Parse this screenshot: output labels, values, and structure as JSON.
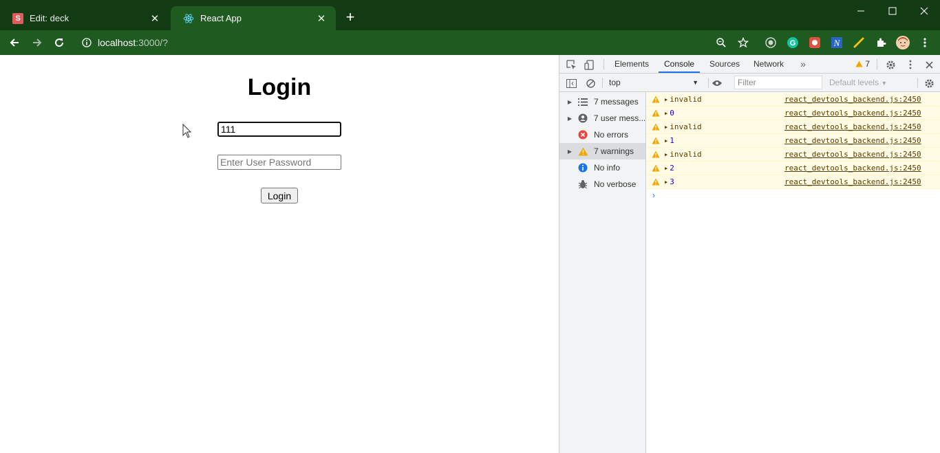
{
  "browser": {
    "tabs": [
      {
        "title": "Edit: deck",
        "favicon_letter": "S"
      },
      {
        "title": "React App"
      }
    ],
    "url_host": "localhost",
    "url_rest": ":3000/?"
  },
  "page": {
    "heading": "Login",
    "username_value": "111",
    "password_placeholder": "Enter User Password",
    "login_button": "Login"
  },
  "devtools": {
    "tabs": [
      "Elements",
      "Console",
      "Sources",
      "Network"
    ],
    "active_tab": "Console",
    "warning_badge": "7",
    "context": "top",
    "filter_placeholder": "Filter",
    "levels": "Default levels",
    "sidebar": [
      {
        "label": "7 messages",
        "icon": "list-icon"
      },
      {
        "label": "7 user mess...",
        "icon": "user-icon"
      },
      {
        "label": "No errors",
        "icon": "error-icon"
      },
      {
        "label": "7 warnings",
        "icon": "warning-icon"
      },
      {
        "label": "No info",
        "icon": "info-icon"
      },
      {
        "label": "No verbose",
        "icon": "bug-icon"
      }
    ],
    "messages": [
      {
        "text": "invalid",
        "source": "react_devtools_backend.js:2450"
      },
      {
        "text": "0",
        "source": "react_devtools_backend.js:2450"
      },
      {
        "text": "invalid",
        "source": "react_devtools_backend.js:2450"
      },
      {
        "text": "1",
        "source": "react_devtools_backend.js:2450"
      },
      {
        "text": "invalid",
        "source": "react_devtools_backend.js:2450"
      },
      {
        "text": "2",
        "source": "react_devtools_backend.js:2450"
      },
      {
        "text": "3",
        "source": "react_devtools_backend.js:2450"
      }
    ],
    "colors": {
      "warning_bg": "#fffbe5",
      "warning_icon": "#f2a600",
      "accent": "#1a73e8"
    }
  }
}
